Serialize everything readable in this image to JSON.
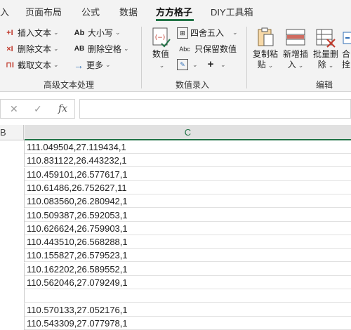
{
  "tabs": [
    {
      "label": "入",
      "active": false
    },
    {
      "label": "页面布局",
      "active": false
    },
    {
      "label": "公式",
      "active": false
    },
    {
      "label": "数据",
      "active": false
    },
    {
      "label": "方方格子",
      "active": true
    },
    {
      "label": "DIY工具箱",
      "active": false
    }
  ],
  "ribbon": {
    "text_group": {
      "label": "高级文本处理",
      "insert_text": "插入文本",
      "delete_text": "删除文本",
      "extract_text": "截取文本",
      "case": "大小写",
      "delete_space": "删除空格",
      "more": "更多",
      "case_icon": "Ab",
      "space_icon": "AB"
    },
    "number_group": {
      "label": "数值录入",
      "value_label": "数值",
      "round": "四舍五入",
      "keep_value": "只保留数值",
      "keep_icon": "Abc"
    },
    "edit_group": {
      "label": "编辑",
      "copy_paste": "复制粘贴",
      "copy_paste_l1": "复制粘",
      "copy_paste_l2": "贴",
      "new_insert_l1": "新增插",
      "new_insert_l2": "入",
      "batch_delete_l1": "批量删",
      "batch_delete_l2": "除",
      "merge_l1": "合",
      "merge_l2": "拴"
    }
  },
  "formula_bar": {
    "cancel_icon": "✕",
    "confirm_icon": "✓",
    "fx_label": "fx",
    "value": ""
  },
  "grid": {
    "col_b": "B",
    "col_c": "C",
    "rows": [
      "111.049504,27.119434,1",
      "110.831122,26.443232,1",
      "110.459101,26.577617,1",
      "110.61486,26.752627,11",
      "110.083560,26.280942,1",
      "110.509387,26.592053,1",
      "110.626624,26.759903,1",
      "110.443510,26.568288,1",
      "110.155827,26.579523,1",
      "110.162202,26.589552,1",
      "110.562046,27.079249,1",
      "",
      "110.570133,27.052176,1",
      "110.543309,27.077978,1"
    ]
  },
  "colors": {
    "accent": "#217346",
    "ribbon_bg": "#f3f3f3",
    "icon_red": "#c0392b",
    "icon_blue": "#2f6db5"
  }
}
